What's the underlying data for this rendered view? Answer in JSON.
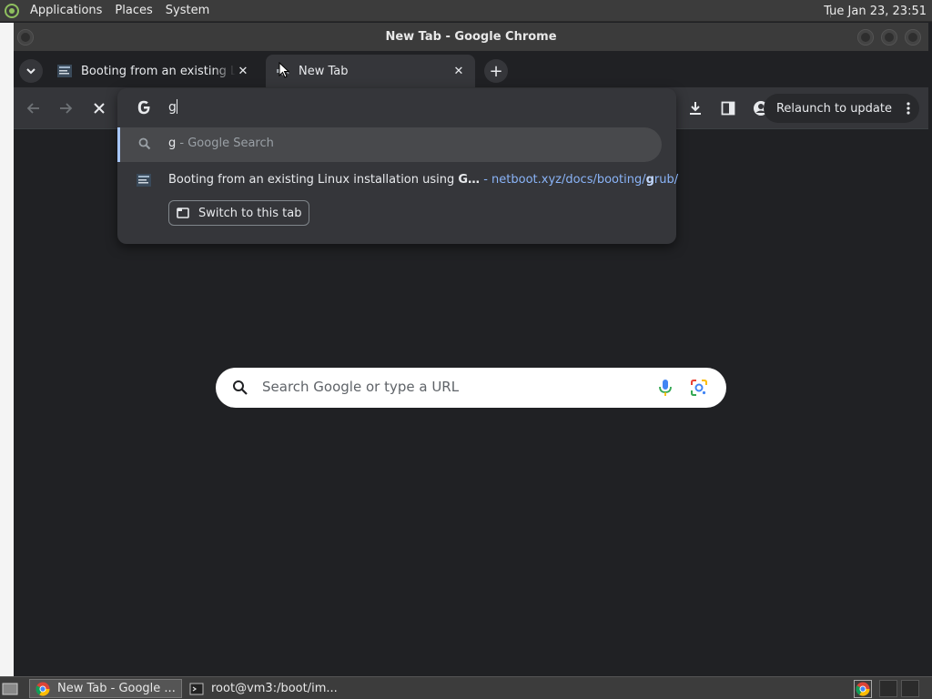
{
  "top_panel": {
    "menus": [
      "Applications",
      "Places",
      "System"
    ],
    "clock": "Tue Jan 23, 23:51"
  },
  "window": {
    "title": "New Tab - Google Chrome"
  },
  "tabs": [
    {
      "title": "Booting from an existing Linux installation using GRUB",
      "active": false
    },
    {
      "title": "New Tab",
      "active": true
    }
  ],
  "toolbar": {
    "relaunch_label": "Relaunch to update"
  },
  "omnibox": {
    "query": "g",
    "suggestions": {
      "search": {
        "query": "g",
        "suffix": " - Google Search"
      },
      "open_tab": {
        "title_prefix": "Booting from an existing Linux installation using ",
        "title_bold": "G…",
        "separator": " - ",
        "url_prefix": "netboot.xyz/docs/booting/",
        "url_bold": "g",
        "url_suffix": "rub/",
        "switch_label": "Switch to this tab"
      }
    }
  },
  "ntp": {
    "search_placeholder": "Search Google or type a URL"
  },
  "taskbar": {
    "items": [
      {
        "label": "New Tab - Google ...",
        "active": true
      },
      {
        "label": "root@vm3:/boot/im...",
        "active": false
      }
    ]
  },
  "colors": {
    "accent": "#8ab4f8",
    "selection_bar": "#a8c7fa"
  }
}
